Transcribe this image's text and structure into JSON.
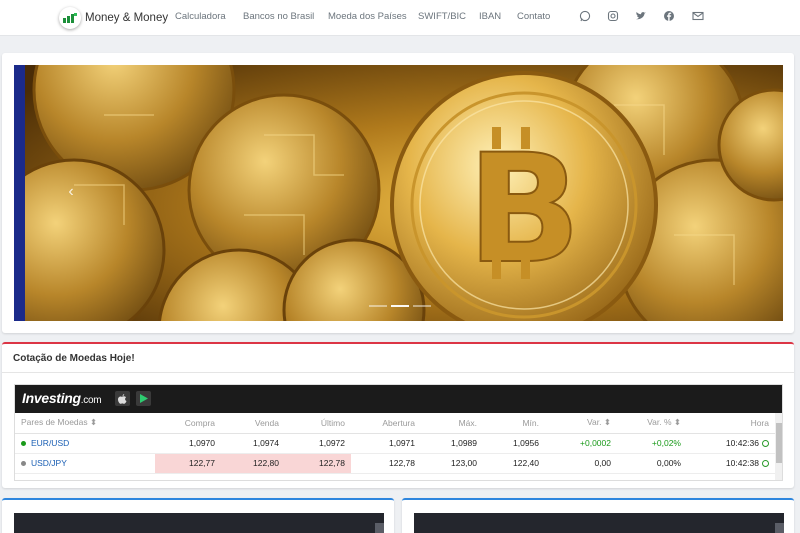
{
  "brand": {
    "name": "Money & Money",
    "logo_icon": "money-logo-icon"
  },
  "nav": {
    "links": [
      "Calculadora",
      "Bancos no Brasil",
      "Moeda dos Países",
      "SWIFT/BIC",
      "IBAN",
      "Contato"
    ],
    "social_icons": [
      "whatsapp-icon",
      "instagram-icon",
      "twitter-icon",
      "facebook-icon",
      "email-icon"
    ]
  },
  "carousel": {
    "image": "golden-bitcoin-coins",
    "slide_count": 3,
    "active_slide": 2,
    "prev_icon": "chevron-left-icon"
  },
  "quotes": {
    "title": "Cotação de Moedas Hoje!",
    "widget": {
      "logo": "Investing",
      "logo_suffix": ".com",
      "columns": [
        "Pares de Moedas ⬍",
        "Compra",
        "Venda",
        "Último",
        "Abertura",
        "Máx.",
        "Mín.",
        "Var. ⬍",
        "Var. % ⬍",
        "Hora"
      ],
      "rows": [
        {
          "pair": "EUR/USD",
          "dot_color": "#1a9a1a",
          "compra": "1,0970",
          "venda": "1,0974",
          "ultimo": "1,0972",
          "abertura": "1,0971",
          "max": "1,0989",
          "min": "1,0956",
          "var": "+0,0002",
          "var_pct": "+0,02%",
          "hora": "10:42:36"
        },
        {
          "pair": "USD/JPY",
          "dot_color": "#888888",
          "compra": "122,77",
          "venda": "122,80",
          "ultimo": "122,78",
          "abertura": "122,78",
          "max": "123,00",
          "min": "122,40",
          "var": "0,00",
          "var_pct": "0,00%",
          "hora": "10:42:38"
        }
      ]
    }
  },
  "colors": {
    "accent_red": "#dc3545",
    "accent_blue": "#2e86de",
    "positive": "#1a9a1a",
    "highlight": "#f9d6d6"
  }
}
